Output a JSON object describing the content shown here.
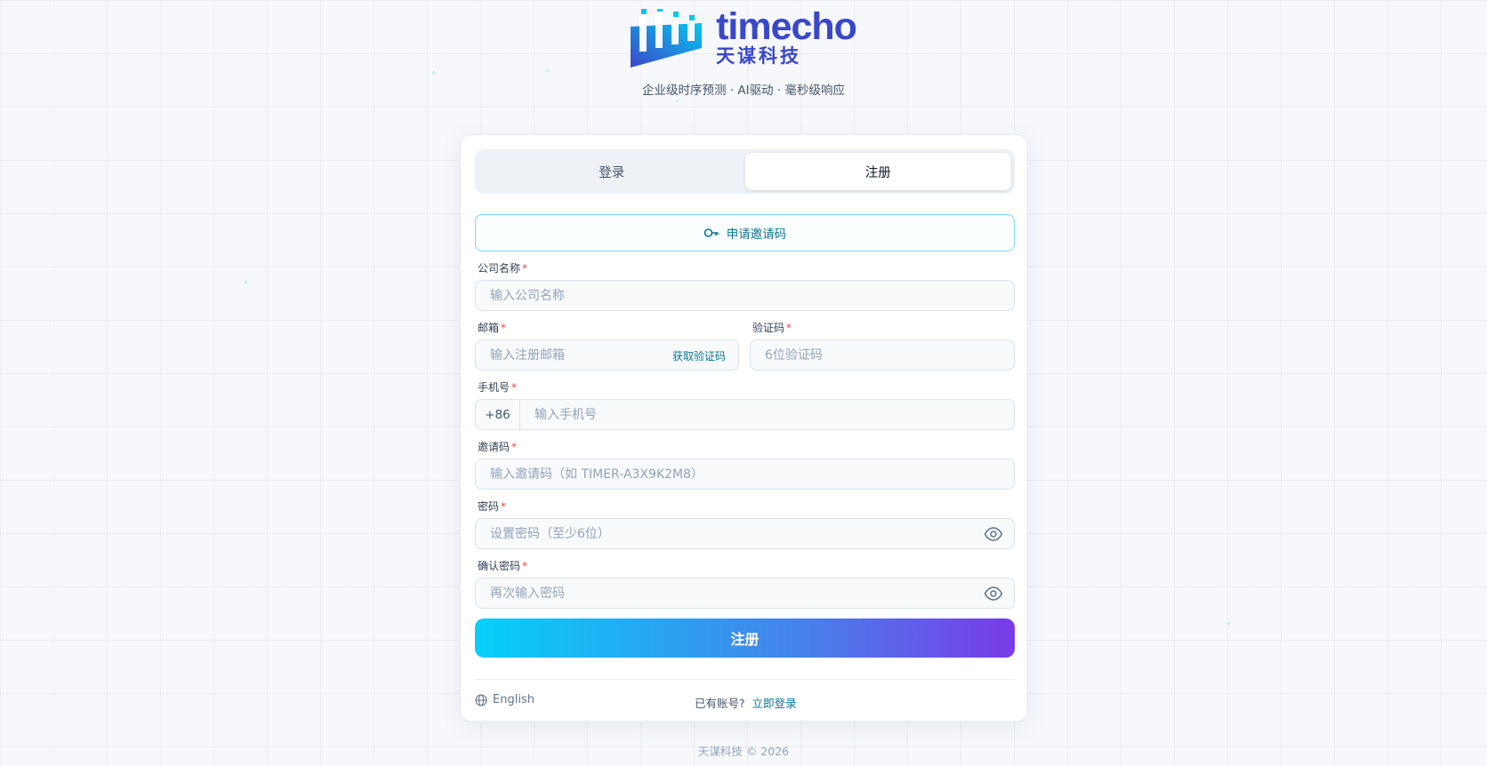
{
  "brand": {
    "name": "timecho",
    "name_cn": "天谋科技",
    "tagline": "企业级时序预测 · AI驱动 · 毫秒级响应"
  },
  "tabs": [
    {
      "label": "登录",
      "active": false
    },
    {
      "label": "注册",
      "active": true
    }
  ],
  "apply_invite": {
    "label": "申请邀请码",
    "icon": "key-icon"
  },
  "form": {
    "company": {
      "label": "公司名称",
      "placeholder": "输入公司名称",
      "value": ""
    },
    "email": {
      "label": "邮箱",
      "placeholder": "输入注册邮箱",
      "get_code_label": "获取验证码",
      "value": ""
    },
    "verify_code": {
      "label": "验证码",
      "placeholder": "6位验证码",
      "value": ""
    },
    "phone": {
      "label": "手机号",
      "prefix": "+86",
      "placeholder": "输入手机号",
      "value": ""
    },
    "invite_code": {
      "label": "邀请码",
      "placeholder": "输入邀请码（如 TIMER-A3X9K2M8）",
      "value": ""
    },
    "password": {
      "label": "密码",
      "placeholder": "设置密码（至少6位）",
      "value": ""
    },
    "confirm_password": {
      "label": "确认密码",
      "placeholder": "再次输入密码",
      "value": ""
    },
    "required_mark": "*"
  },
  "submit_label": "注册",
  "footer_card": {
    "language": "English",
    "has_account": "已有账号?",
    "login_link": "立即登录"
  },
  "copyright": "天谋科技 © 2026",
  "colors": {
    "accent": "#0e7490",
    "brand": "#3b47c9",
    "gradient_start": "#06d0f9",
    "gradient_end": "#7a3ae8",
    "required": "#ef4444"
  }
}
